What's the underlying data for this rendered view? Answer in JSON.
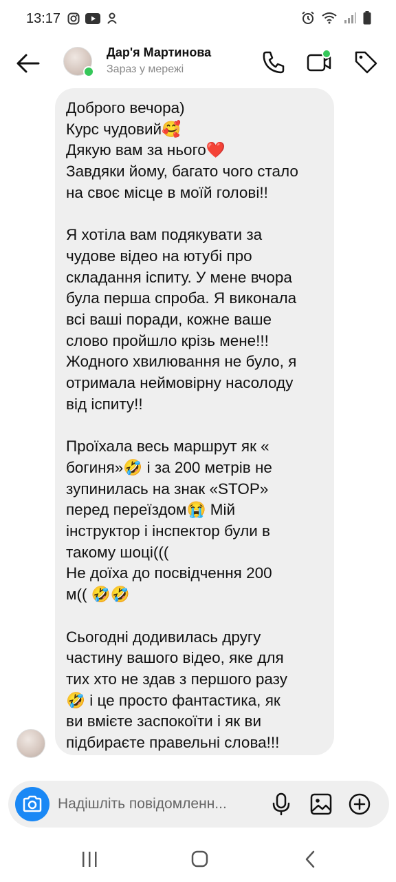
{
  "status_bar": {
    "time": "13:17",
    "left_icons": [
      "instagram-icon",
      "youtube-icon",
      "notification-app-icon"
    ],
    "right_icons": [
      "alarm-icon",
      "wifi-icon",
      "signal-icon",
      "battery-icon"
    ]
  },
  "header": {
    "contact_name": "Дар'я Мартинова",
    "contact_status": "Зараз у мережі",
    "icons": [
      "back-arrow-icon",
      "phone-icon",
      "video-call-icon",
      "tag-icon"
    ]
  },
  "message": {
    "lines": [
      "Доброго вечора)",
      "Курс чудовий🥰",
      "Дякую вам за нього❤️",
      "Завдяки йому, багато чого стало",
      "на своє місце в моїй голові!!",
      "",
      "Я хотіла вам подякувати за",
      "чудове відео на ютубі про",
      "складання іспиту. У мене вчора",
      "була перша спроба. Я виконала",
      "всі ваші поради, кожне ваше",
      "слово пройшло крізь мене!!!",
      "Жодного хвилювання не було, я",
      "отримала неймовірну насолоду",
      "від іспиту!!",
      "",
      "Проїхала весь маршрут як «",
      "богиня»🤣 і за 200 метрів не",
      "зупинилась на знак «STOP»",
      "перед переїздом😭 Мій",
      "інструктор і інспектор були в",
      "такому шоці(((",
      "Не доїха до посвідчення 200",
      "м(( 🤣🤣",
      "",
      "Сьогодні додивилась другу",
      "частину вашого відео, яке для",
      "тих хто не здав з першого разу",
      "🤣 і це просто фантастика, як",
      "ви вмієте заспокоїти і як ви",
      "підбираєте правельні слова!!!"
    ]
  },
  "composer": {
    "placeholder": "Надішліть повідомленн...",
    "icons": [
      "camera-icon",
      "microphone-icon",
      "gallery-icon",
      "plus-icon"
    ]
  },
  "nav_bar": {
    "icons": [
      "recent-apps-icon",
      "home-icon",
      "back-icon"
    ]
  },
  "colors": {
    "accent": "#1a88f5",
    "online": "#35c759",
    "bubble": "#efefef"
  }
}
